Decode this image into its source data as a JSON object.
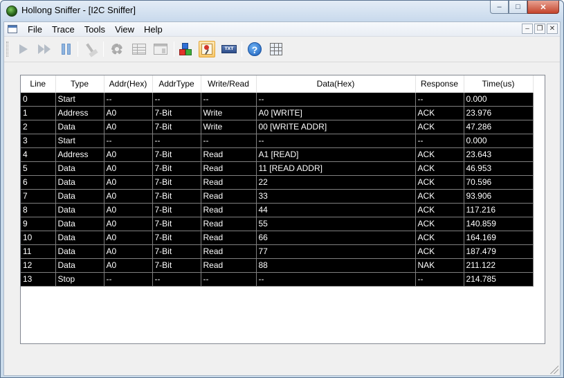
{
  "window": {
    "title": "Hollong Sniffer - [I2C Sniffer]"
  },
  "menu": {
    "items": [
      {
        "label": "File"
      },
      {
        "label": "Trace"
      },
      {
        "label": "Tools"
      },
      {
        "label": "View"
      },
      {
        "label": "Help"
      }
    ]
  },
  "toolbar": {
    "buttons": [
      {
        "name": "play-icon",
        "enabled": false
      },
      {
        "name": "fast-forward-icon",
        "enabled": false
      },
      {
        "name": "pause-icon",
        "enabled": true
      },
      {
        "name": "broom-icon",
        "enabled": false
      },
      {
        "name": "gear-icon",
        "enabled": false
      },
      {
        "name": "table-view-icon",
        "enabled": false
      },
      {
        "name": "panel-view-icon",
        "enabled": false
      },
      {
        "name": "cubes-icon",
        "enabled": true
      },
      {
        "name": "pin-icon",
        "enabled": true,
        "active": true
      },
      {
        "name": "text-export-icon",
        "enabled": true,
        "label": "TXT"
      },
      {
        "name": "help-icon",
        "enabled": true
      },
      {
        "name": "calculator-icon",
        "enabled": true
      }
    ]
  },
  "colors": {
    "start": "#66c7e0",
    "address": "#ee7a2a",
    "data": "#48c04a",
    "write": "#ee3d33",
    "read": "#4a78e8",
    "response": "#d81f6a",
    "stop": "#c81414"
  },
  "table": {
    "columns": [
      "Line",
      "Type",
      "Addr(Hex)",
      "AddrType",
      "Write/Read",
      "Data(Hex)",
      "Response",
      "Time(us)"
    ],
    "rows": [
      {
        "line": "0",
        "type": "Start",
        "addr": "--",
        "addrtype": "--",
        "wr": "--",
        "data": "--",
        "response": "--",
        "time": "0.000"
      },
      {
        "line": "1",
        "type": "Address",
        "addr": "A0",
        "addrtype": "7-Bit",
        "wr": "Write",
        "data": "A0 [WRITE]",
        "response": "ACK",
        "time": "23.976"
      },
      {
        "line": "2",
        "type": "Data",
        "addr": "A0",
        "addrtype": "7-Bit",
        "wr": "Write",
        "data": "00 [WRITE ADDR]",
        "response": "ACK",
        "time": "47.286"
      },
      {
        "line": "3",
        "type": "Start",
        "addr": "--",
        "addrtype": "--",
        "wr": "--",
        "data": "--",
        "response": "--",
        "time": "0.000"
      },
      {
        "line": "4",
        "type": "Address",
        "addr": "A0",
        "addrtype": "7-Bit",
        "wr": "Read",
        "data": "A1 [READ]",
        "response": "ACK",
        "time": "23.643"
      },
      {
        "line": "5",
        "type": "Data",
        "addr": "A0",
        "addrtype": "7-Bit",
        "wr": "Read",
        "data": "11 [READ ADDR]",
        "response": "ACK",
        "time": "46.953"
      },
      {
        "line": "6",
        "type": "Data",
        "addr": "A0",
        "addrtype": "7-Bit",
        "wr": "Read",
        "data": "22",
        "response": "ACK",
        "time": "70.596"
      },
      {
        "line": "7",
        "type": "Data",
        "addr": "A0",
        "addrtype": "7-Bit",
        "wr": "Read",
        "data": "33",
        "response": "ACK",
        "time": "93.906"
      },
      {
        "line": "8",
        "type": "Data",
        "addr": "A0",
        "addrtype": "7-Bit",
        "wr": "Read",
        "data": "44",
        "response": "ACK",
        "time": "117.216"
      },
      {
        "line": "9",
        "type": "Data",
        "addr": "A0",
        "addrtype": "7-Bit",
        "wr": "Read",
        "data": "55",
        "response": "ACK",
        "time": "140.859"
      },
      {
        "line": "10",
        "type": "Data",
        "addr": "A0",
        "addrtype": "7-Bit",
        "wr": "Read",
        "data": "66",
        "response": "ACK",
        "time": "164.169"
      },
      {
        "line": "11",
        "type": "Data",
        "addr": "A0",
        "addrtype": "7-Bit",
        "wr": "Read",
        "data": "77",
        "response": "ACK",
        "time": "187.479"
      },
      {
        "line": "12",
        "type": "Data",
        "addr": "A0",
        "addrtype": "7-Bit",
        "wr": "Read",
        "data": "88",
        "response": "NAK",
        "time": "211.122"
      },
      {
        "line": "13",
        "type": "Stop",
        "addr": "--",
        "addrtype": "--",
        "wr": "--",
        "data": "--",
        "response": "--",
        "time": "214.785"
      }
    ]
  }
}
